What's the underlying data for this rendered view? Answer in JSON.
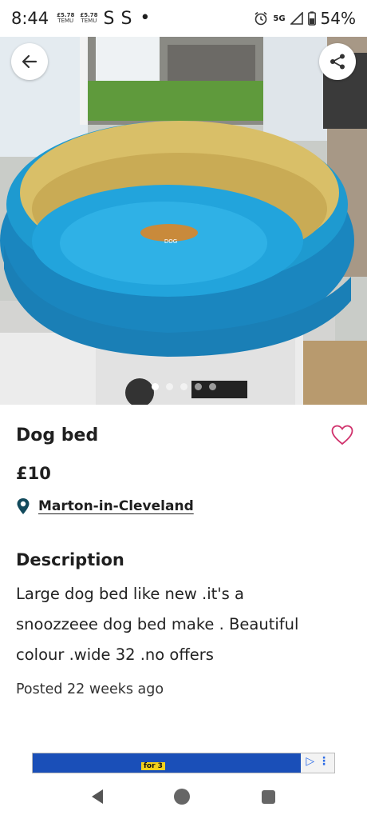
{
  "status_bar": {
    "time": "8:44",
    "notif_1_price": "£5.78",
    "notif_1_label": "TEMU",
    "notif_2_price": "£5.78",
    "notif_2_label": "TEMU",
    "s1": "S",
    "s2": "S",
    "dot": "•",
    "network": "5G",
    "battery": "54%",
    "icons": [
      "alarm-icon",
      "signal-icon",
      "battery-icon"
    ]
  },
  "gallery": {
    "image_count": 5,
    "active_index": 1,
    "back_icon": "arrow-left-icon",
    "share_icon": "share-icon"
  },
  "listing": {
    "title": "Dog bed",
    "price": "£10",
    "location": "Marton-in-Cleveland",
    "location_icon": "map-pin-icon",
    "favourite_icon": "heart-outline-icon",
    "description_heading": "Description",
    "description_line_1": "Large dog bed like new .it's a",
    "description_line_2": "snoozzeee dog bed make . Beautiful",
    "description_line_3": "colour .wide 32  .no offers",
    "posted": "Posted 22 weeks ago"
  },
  "ad": {
    "offer_text": "for 3",
    "adchoices_icon": "adchoices-icon"
  },
  "navbar": {
    "icons": [
      "nav-back-icon",
      "nav-home-icon",
      "nav-recents-icon"
    ]
  },
  "colors": {
    "accent": "#1a7fa8",
    "heart": "#d0306b",
    "location_pin": "#124a5c",
    "bed_blue": "#1e9ad0",
    "bed_yellow": "#d9bf68"
  }
}
